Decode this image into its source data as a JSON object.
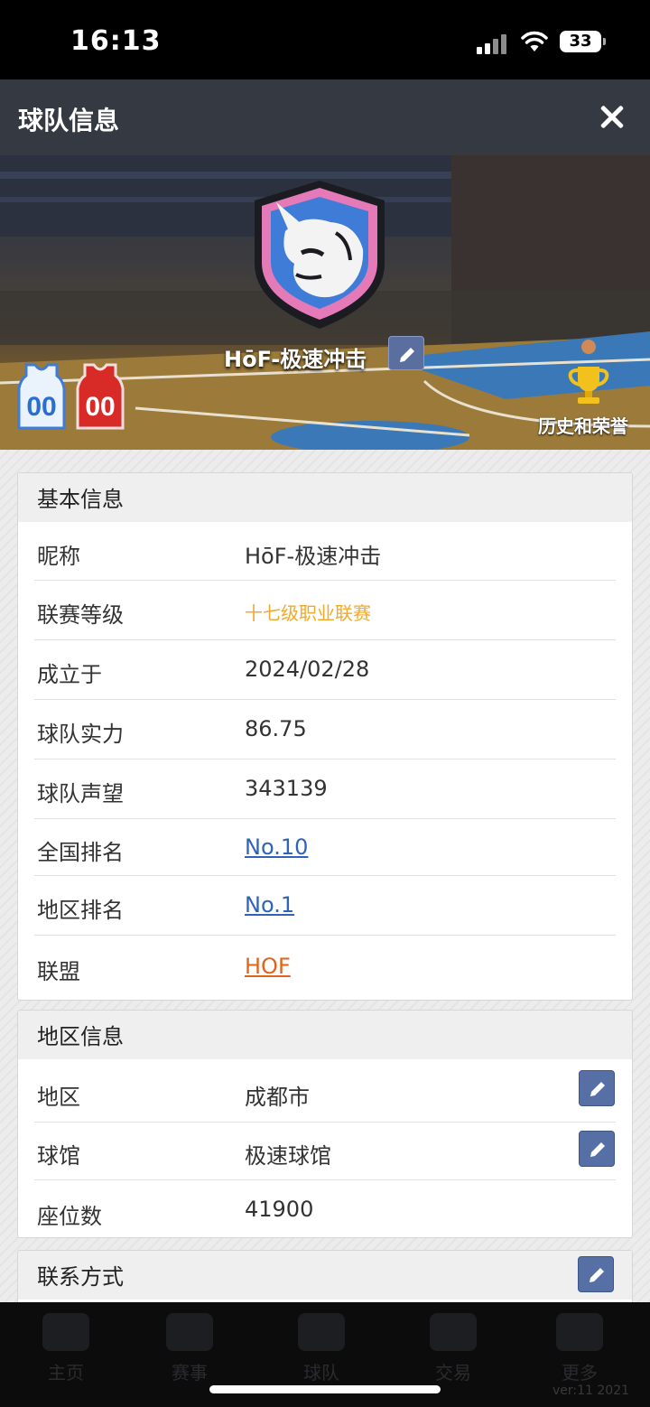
{
  "status_bar": {
    "time": "16:13",
    "battery": "33"
  },
  "header": {
    "title": "球队信息"
  },
  "hero": {
    "team_name": "HōF-极速冲击",
    "jersey_home_number": "00",
    "jersey_away_number": "00",
    "history_label": "历史和荣誉",
    "colors": {
      "logo_frame": "#e47ab7",
      "logo_blue": "#3e7cd8",
      "jersey_home": "#eaf2fb",
      "jersey_away": "#d82b27"
    }
  },
  "basic_info": {
    "title": "基本信息",
    "rows": [
      {
        "label": "昵称",
        "value": "HōF-极速冲击"
      },
      {
        "label": "联赛等级",
        "value": "十七级职业联赛"
      },
      {
        "label": "成立于",
        "value": "2024/02/28"
      },
      {
        "label": "球队实力",
        "value": "86.75"
      },
      {
        "label": "球队声望",
        "value": "343139"
      },
      {
        "label": "全国排名",
        "value": "No.10"
      },
      {
        "label": "地区排名",
        "value": "No.1"
      },
      {
        "label": "联盟",
        "value": "HOF"
      }
    ]
  },
  "region_info": {
    "title": "地区信息",
    "rows": [
      {
        "label": "地区",
        "value": "成都市"
      },
      {
        "label": "球馆",
        "value": "极速球馆"
      },
      {
        "label": "座位数",
        "value": "41900"
      }
    ]
  },
  "contact": {
    "title": "联系方式"
  },
  "bottom_nav": {
    "items": [
      "主页",
      "赛事",
      "球队",
      "交易",
      "更多"
    ],
    "version": "ver:11  2021"
  },
  "icons": {
    "close": "close-icon",
    "edit": "pencil-icon",
    "trophy": "trophy-icon",
    "logo": "rhino-shield-logo"
  }
}
